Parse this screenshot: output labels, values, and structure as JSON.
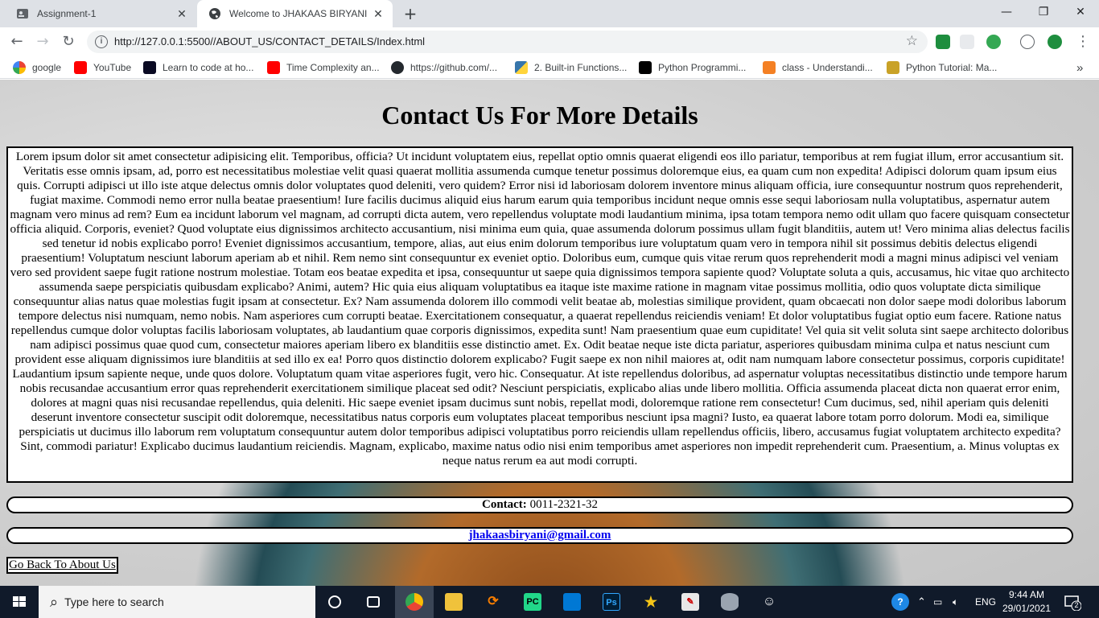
{
  "browser": {
    "tabs": [
      {
        "title": "Assignment-1",
        "active": false
      },
      {
        "title": "Welcome to JHAKAAS BIRYANI",
        "active": true
      }
    ],
    "new_tab": "+",
    "url": "http://127.0.0.1:5500//ABOUT_US/CONTACT_DETAILS/Index.html",
    "bookmarks": [
      {
        "label": "google",
        "icon": "google-icon"
      },
      {
        "label": "YouTube",
        "icon": "youtube-icon"
      },
      {
        "label": "Learn to code at ho...",
        "icon": "freecodecamp-icon"
      },
      {
        "label": "Time Complexity an...",
        "icon": "youtube-icon"
      },
      {
        "label": "https://github.com/...",
        "icon": "github-icon"
      },
      {
        "label": "2. Built-in Functions...",
        "icon": "python-icon"
      },
      {
        "label": "Python Programmi...",
        "icon": "sf-icon"
      },
      {
        "label": "class - Understandi...",
        "icon": "stackoverflow-icon"
      },
      {
        "label": "Python Tutorial: Ma...",
        "icon": "tutorial-icon"
      }
    ],
    "more_bookmarks": "»"
  },
  "page": {
    "heading": "Contact Us For More Details",
    "body": "Lorem ipsum dolor sit amet consectetur adipisicing elit. Temporibus, officia? Ut incidunt voluptatem eius, repellat optio omnis quaerat eligendi eos illo pariatur, temporibus at rem fugiat illum, error accusantium sit. Veritatis esse omnis ipsam, ad, porro est necessitatibus molestiae velit quasi quaerat mollitia assumenda cumque tenetur possimus doloremque eius, ea quam cum non expedita! Adipisci dolorum quam ipsum eius quis. Corrupti adipisci ut illo iste atque delectus omnis dolor voluptates quod deleniti, vero quidem? Error nisi id laboriosam dolorem inventore minus aliquam officia, iure consequuntur nostrum quos reprehenderit, fugiat maxime. Commodi nemo error nulla beatae praesentium! Iure facilis ducimus aliquid eius harum earum quia temporibus incidunt neque omnis esse sequi laboriosam nulla voluptatibus, aspernatur autem magnam vero minus ad rem? Eum ea incidunt laborum vel magnam, ad corrupti dicta autem, vero repellendus voluptate modi laudantium minima, ipsa totam tempora nemo odit ullam quo facere quisquam consectetur officia aliquid. Corporis, eveniet? Quod voluptate eius dignissimos architecto accusantium, nisi minima eum quia, quae assumenda dolorum possimus ullam fugit blanditiis, autem ut! Vero minima alias delectus facilis sed tenetur id nobis explicabo porro! Eveniet dignissimos accusantium, tempore, alias, aut eius enim dolorum temporibus iure voluptatum quam vero in tempora nihil sit possimus debitis delectus eligendi praesentium! Voluptatum nesciunt laborum aperiam ab et nihil. Rem nemo sint consequuntur ex eveniet optio. Doloribus eum, cumque quis vitae rerum quos reprehenderit modi a magni minus adipisci vel veniam vero sed provident saepe fugit ratione nostrum molestiae. Totam eos beatae expedita et ipsa, consequuntur ut saepe quia dignissimos tempora sapiente quod? Voluptate soluta a quis, accusamus, hic vitae quo architecto assumenda saepe perspiciatis quibusdam explicabo? Animi, autem? Hic quia eius aliquam voluptatibus ea itaque iste maxime ratione in magnam vitae possimus mollitia, odio quos voluptate dicta similique consequuntur alias natus quae molestias fugit ipsam at consectetur. Ex? Nam assumenda dolorem illo commodi velit beatae ab, molestias similique provident, quam obcaecati non dolor saepe modi doloribus laborum tempore delectus nisi numquam, nemo nobis. Nam asperiores cum corrupti beatae. Exercitationem consequatur, a quaerat repellendus reiciendis veniam! Et dolor voluptatibus fugiat optio eum facere. Ratione natus repellendus cumque dolor voluptas facilis laboriosam voluptates, ab laudantium quae corporis dignissimos, expedita sunt! Nam praesentium quae eum cupiditate! Vel quia sit velit soluta sint saepe architecto doloribus nam adipisci possimus quae quod cum, consectetur maiores aperiam libero ex blanditiis esse distinctio amet. Ex. Odit beatae neque iste dicta pariatur, asperiores quibusdam minima culpa et natus nesciunt cum provident esse aliquam dignissimos iure blanditiis at sed illo ex ea! Porro quos distinctio dolorem explicabo? Fugit saepe ex non nihil maiores at, odit nam numquam labore consectetur possimus, corporis cupiditate! Laudantium ipsum sapiente neque, unde quos dolore. Voluptatum quam vitae asperiores fugit, vero hic. Consequatur. At iste repellendus doloribus, ad aspernatur voluptas necessitatibus distinctio unde tempore harum nobis recusandae accusantium error quas reprehenderit exercitationem similique placeat sed odit? Nesciunt perspiciatis, explicabo alias unde libero mollitia. Officia assumenda placeat dicta non quaerat error enim, dolores at magni quas nisi recusandae repellendus, quia deleniti. Hic saepe eveniet ipsam ducimus sunt nobis, repellat modi, doloremque ratione rem consectetur! Cum ducimus, sed, nihil aperiam quis deleniti deserunt inventore consectetur suscipit odit doloremque, necessitatibus natus corporis eum voluptates placeat temporibus nesciunt ipsa magni? Iusto, ea quaerat labore totam porro dolorum. Modi ea, similique perspiciatis ut ducimus illo laborum rem voluptatum consequuntur autem dolor temporibus adipisci voluptatibus porro reiciendis ullam repellendus officiis, libero, accusamus fugiat voluptatem architecto expedita? Sint, commodi pariatur! Explicabo ducimus laudantium reiciendis. Magnam, explicabo, maxime natus odio nisi enim temporibus amet asperiores non impedit reprehenderit cum. Praesentium, a. Minus voluptas ex neque natus rerum ea aut modi corrupti.",
    "contact_label": "Contact:",
    "contact_value": "0011-2321-32",
    "email": "jhakaasbiryani@gmail.com",
    "back_link": "Go Back To About Us"
  },
  "taskbar": {
    "search_placeholder": "Type here to search",
    "language": "ENG",
    "time": "9:44 AM",
    "date": "29/01/2021",
    "notification_count": "2"
  },
  "colors": {
    "tabstrip": "#dee1e6",
    "taskbar": "#101a2a",
    "link": "#0000ee"
  }
}
